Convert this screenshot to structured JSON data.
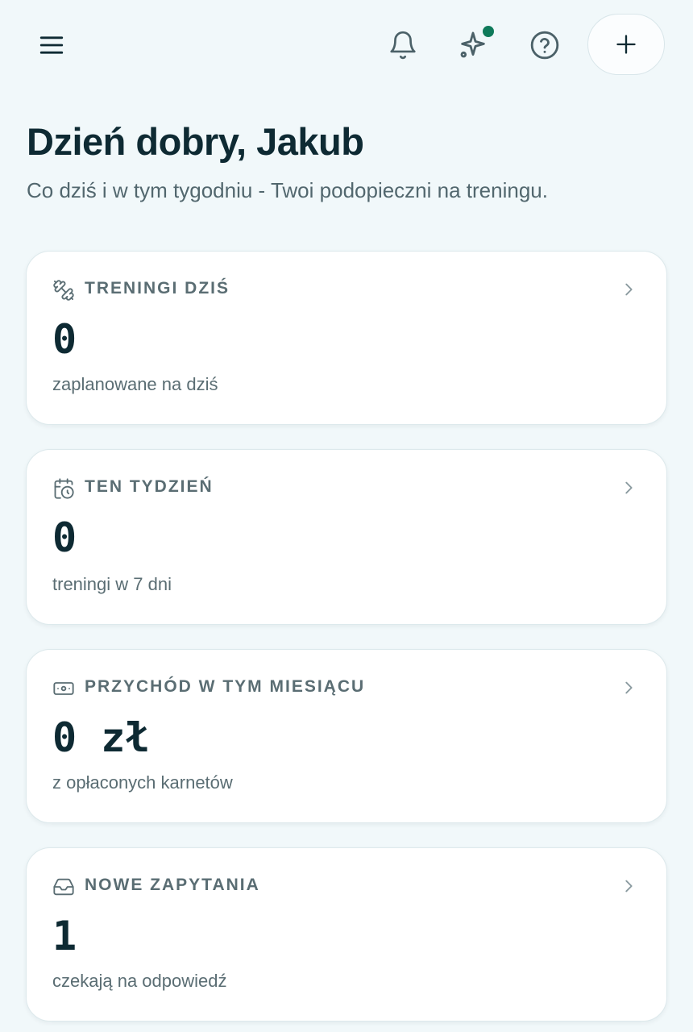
{
  "header": {
    "menu_icon": "menu-icon",
    "notifications_icon": "bell-icon",
    "ai_icon": "sparkles-icon",
    "help_icon": "help-circle-icon",
    "add_label": "+"
  },
  "greeting": {
    "title": "Dzień dobry, Jakub",
    "subtitle": "Co dziś i w tym tygodniu - Twoi podopieczni na treningu."
  },
  "cards": [
    {
      "icon": "dumbbell-icon",
      "label": "TRENINGI DZIŚ",
      "value": "0",
      "description": "zaplanowane na dziś"
    },
    {
      "icon": "calendar-clock-icon",
      "label": "TEN TYDZIEŃ",
      "value": "0",
      "description": "treningi w 7 dni"
    },
    {
      "icon": "banknote-icon",
      "label": "PRZYCHÓD W TYM MIESIĄCU",
      "value": "0 zł",
      "description": "z opłaconych karnetów"
    },
    {
      "icon": "inbox-icon",
      "label": "NOWE ZAPYTANIA",
      "value": "1",
      "description": "czekają na odpowiedź"
    }
  ],
  "colors": {
    "background": "#f1f8fa",
    "text_primary": "#0e2a33",
    "text_secondary": "#5a6d73",
    "notification_dot": "#0f7a5a",
    "card_border": "#dde9ec"
  }
}
